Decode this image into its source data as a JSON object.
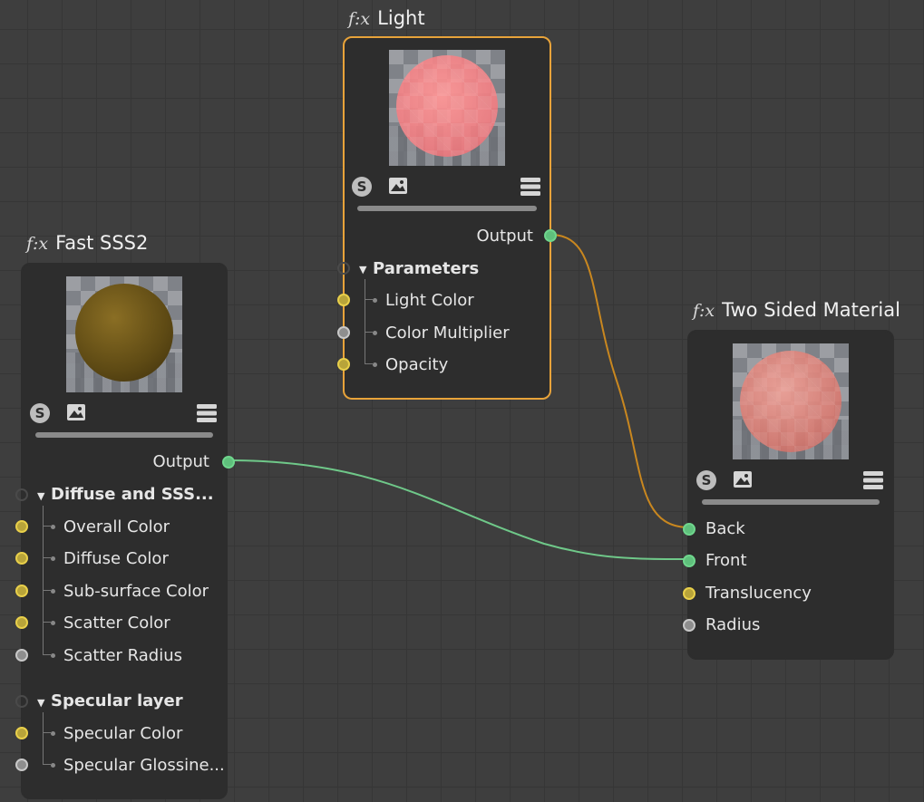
{
  "nodes": {
    "light": {
      "fx_label": "f:x",
      "title": "Light",
      "output_label": "Output",
      "group_label": "Parameters",
      "ports": [
        "Light Color",
        "Color Multiplier",
        "Opacity"
      ]
    },
    "fast_sss2": {
      "fx_label": "f:x",
      "title": "Fast SSS2",
      "output_label": "Output",
      "group1_label": "Diffuse and SSS...",
      "group1_ports": [
        "Overall Color",
        "Diffuse Color",
        "Sub-surface Color",
        "Scatter Color",
        "Scatter Radius"
      ],
      "group2_label": "Specular layer",
      "group2_ports": [
        "Specular Color",
        "Specular Glossine..."
      ]
    },
    "two_sided": {
      "fx_label": "f:x",
      "title": "Two Sided Material",
      "ports": [
        "Back",
        "Front",
        "Translucency",
        "Radius"
      ]
    }
  },
  "icons": {
    "s": "S",
    "image": "image-icon",
    "menu": "menu-icon"
  },
  "colors": {
    "selected_border": "#e8a33a",
    "wire_orange": "#c9871f",
    "wire_green": "#6fc889",
    "port_yellow": "#e8cf4a",
    "port_gray": "#c8c8c8",
    "port_green": "#6fd68d"
  }
}
